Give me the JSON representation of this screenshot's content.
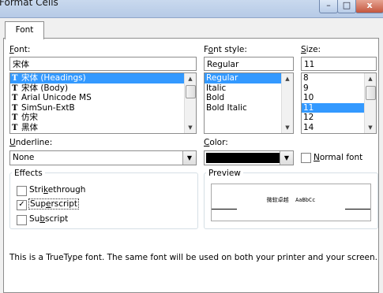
{
  "window": {
    "title": "Format Cells",
    "minimize_glyph": "–",
    "maximize_glyph": "□",
    "close_glyph": "x"
  },
  "tabs": [
    {
      "label": "Font"
    }
  ],
  "font": {
    "label": "Font:",
    "value": "宋体",
    "items": [
      "宋体 (Headings)",
      "宋体 (Body)",
      "Arial Unicode MS",
      "SimSun-ExtB",
      "仿宋",
      "黑体"
    ],
    "selected_index": 0
  },
  "font_style": {
    "label": "Font style:",
    "value": "Regular",
    "items": [
      "Regular",
      "Italic",
      "Bold",
      "Bold Italic"
    ],
    "selected_index": 0
  },
  "size": {
    "label": "Size:",
    "value": "11",
    "items": [
      "8",
      "9",
      "10",
      "11",
      "12",
      "14"
    ],
    "selected_index": 3
  },
  "underline": {
    "label": "Underline:",
    "value": "None"
  },
  "color": {
    "label": "Color:",
    "swatch": "#000000"
  },
  "normal_font": {
    "label": "Normal font",
    "checked": false
  },
  "effects": {
    "title": "Effects",
    "strikethrough": {
      "label": "Strikethrough",
      "checked": false
    },
    "superscript": {
      "label": "Superscript",
      "checked": true
    },
    "subscript": {
      "label": "Subscript",
      "checked": false
    }
  },
  "preview": {
    "title": "Preview",
    "sample": "微软卓越  AaBbCc"
  },
  "info_text": "This is a TrueType font.  The same font will be used on both your printer and your screen.",
  "icons": {
    "truetype": "T"
  }
}
